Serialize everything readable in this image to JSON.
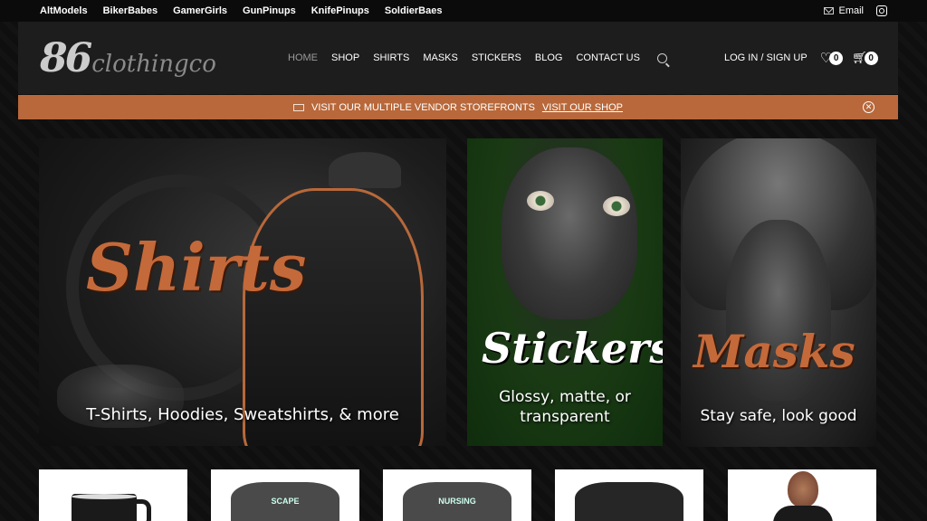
{
  "topbar": {
    "links": [
      "AltModels",
      "BikerBabes",
      "GamerGirls",
      "GunPinups",
      "KnifePinups",
      "SoldierBaes"
    ],
    "email_label": "Email",
    "instagram_icon": "instagram-icon"
  },
  "header": {
    "logo_number": "86",
    "logo_text": "clothingco",
    "nav": [
      "HOME",
      "SHOP",
      "SHIRTS",
      "MASKS",
      "STICKERS",
      "BLOG",
      "CONTACT US"
    ],
    "active_nav": "HOME",
    "login_label": "LOG IN / SIGN UP",
    "wishlist_count": "0",
    "cart_count": "0"
  },
  "promo": {
    "text": "VISIT OUR MULTIPLE VENDOR STOREFRONTS",
    "link": "VISIT OUR SHOP",
    "accent": "#b8683a"
  },
  "banners": {
    "shirts": {
      "title": "Shirts",
      "subtitle": "T-Shirts, Hoodies, Sweatshirts, & more"
    },
    "stickers": {
      "title": "Stickers",
      "subtitle_line1": "Glossy, matte, or",
      "subtitle_line2": "transparent"
    },
    "masks": {
      "title": "Masks",
      "subtitle": "Stay safe, look good"
    }
  },
  "products": [
    {
      "type": "mug"
    },
    {
      "type": "tee",
      "print": "SCAPE"
    },
    {
      "type": "tee",
      "print": "NURSING"
    },
    {
      "type": "tee-dark"
    },
    {
      "type": "tank-top"
    }
  ]
}
